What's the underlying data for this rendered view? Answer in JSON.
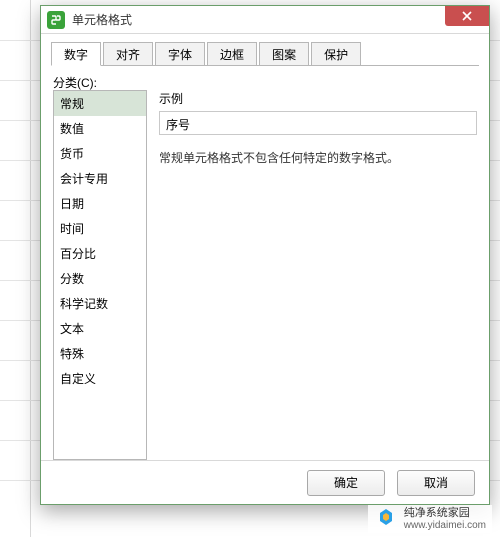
{
  "window": {
    "title": "单元格格式",
    "close_icon": "close"
  },
  "tabs": [
    {
      "label": "数字",
      "active": true
    },
    {
      "label": "对齐",
      "active": false
    },
    {
      "label": "字体",
      "active": false
    },
    {
      "label": "边框",
      "active": false
    },
    {
      "label": "图案",
      "active": false
    },
    {
      "label": "保护",
      "active": false
    }
  ],
  "category_label": "分类(C):",
  "categories": [
    {
      "label": "常规",
      "selected": true
    },
    {
      "label": "数值",
      "selected": false
    },
    {
      "label": "货币",
      "selected": false
    },
    {
      "label": "会计专用",
      "selected": false
    },
    {
      "label": "日期",
      "selected": false
    },
    {
      "label": "时间",
      "selected": false
    },
    {
      "label": "百分比",
      "selected": false
    },
    {
      "label": "分数",
      "selected": false
    },
    {
      "label": "科学记数",
      "selected": false
    },
    {
      "label": "文本",
      "selected": false
    },
    {
      "label": "特殊",
      "selected": false
    },
    {
      "label": "自定义",
      "selected": false
    }
  ],
  "example": {
    "label": "示例",
    "value": "序号"
  },
  "description": "常规单元格格式不包含任何特定的数字格式。",
  "footer": {
    "ok_label": "确定",
    "cancel_label": "取消"
  },
  "watermark": {
    "line1": "纯净系统家园",
    "line2": "www.yidaimei.com"
  }
}
